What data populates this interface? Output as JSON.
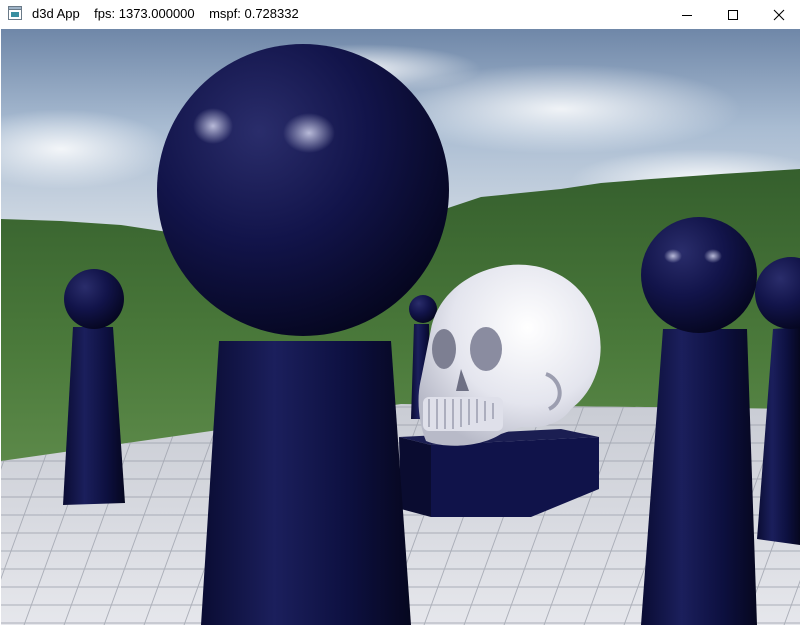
{
  "window": {
    "title": "d3d App    fps: 1373.000000    mspf: 0.728332",
    "icon": "app-window-icon",
    "controls": {
      "minimize_icon": "minimize-icon",
      "maximize_icon": "maximize-icon",
      "close_icon": "close-icon"
    }
  },
  "scene": {
    "objects": [
      "sky",
      "grassy-hills",
      "tiled-floor",
      "skull",
      "box",
      "columns",
      "spheres"
    ],
    "colors": {
      "sphere": "#0d0f3a",
      "column": "#0b0e36",
      "skull": "#e8e8ef",
      "sky": "#8fa7c4",
      "hills": "#3f6b33"
    }
  }
}
